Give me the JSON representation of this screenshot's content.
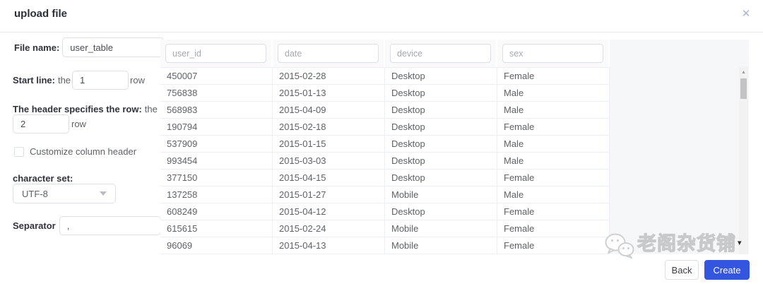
{
  "dialog": {
    "title": "upload file",
    "close_glyph": "✕"
  },
  "form": {
    "file_name": {
      "label": "File name:",
      "value": "user_table"
    },
    "start_line": {
      "label_bold": "Start line:",
      "label_after": "the",
      "value": "1",
      "suffix": "row"
    },
    "header_row": {
      "label_bold": "The header specifies the row:",
      "label_after": "the",
      "value": "2",
      "suffix": "row"
    },
    "customize": {
      "label": "Customize column header",
      "checked": false
    },
    "charset": {
      "label": "character set:",
      "value": "UTF-8"
    },
    "separator": {
      "label": "Separator",
      "value": ","
    }
  },
  "table": {
    "columns": [
      {
        "key": "user_id",
        "placeholder": "user_id"
      },
      {
        "key": "date",
        "placeholder": "date"
      },
      {
        "key": "device",
        "placeholder": "device"
      },
      {
        "key": "sex",
        "placeholder": "sex"
      }
    ],
    "rows": [
      {
        "user_id": "450007",
        "date": "2015-02-28",
        "device": "Desktop",
        "sex": "Female"
      },
      {
        "user_id": "756838",
        "date": "2015-01-13",
        "device": "Desktop",
        "sex": "Male"
      },
      {
        "user_id": "568983",
        "date": "2015-04-09",
        "device": "Desktop",
        "sex": "Male"
      },
      {
        "user_id": "190794",
        "date": "2015-02-18",
        "device": "Desktop",
        "sex": "Female"
      },
      {
        "user_id": "537909",
        "date": "2015-01-15",
        "device": "Desktop",
        "sex": "Male"
      },
      {
        "user_id": "993454",
        "date": "2015-03-03",
        "device": "Desktop",
        "sex": "Male"
      },
      {
        "user_id": "377150",
        "date": "2015-04-15",
        "device": "Desktop",
        "sex": "Female"
      },
      {
        "user_id": "137258",
        "date": "2015-01-27",
        "device": "Mobile",
        "sex": "Male"
      },
      {
        "user_id": "608249",
        "date": "2015-04-12",
        "device": "Desktop",
        "sex": "Female"
      },
      {
        "user_id": "615615",
        "date": "2015-02-24",
        "device": "Mobile",
        "sex": "Female"
      },
      {
        "user_id": "96069",
        "date": "2015-04-13",
        "device": "Mobile",
        "sex": "Female"
      }
    ]
  },
  "scrollbar": {
    "up_glyph": "▲"
  },
  "watermark": {
    "text": "老阁杂货铺",
    "caret": "▾"
  },
  "footer": {
    "back_label": "Back",
    "create_label": "Create"
  },
  "colors": {
    "primary": "#3355e0",
    "table_border": "#ebeef5",
    "header_bg": "#fafafa"
  }
}
